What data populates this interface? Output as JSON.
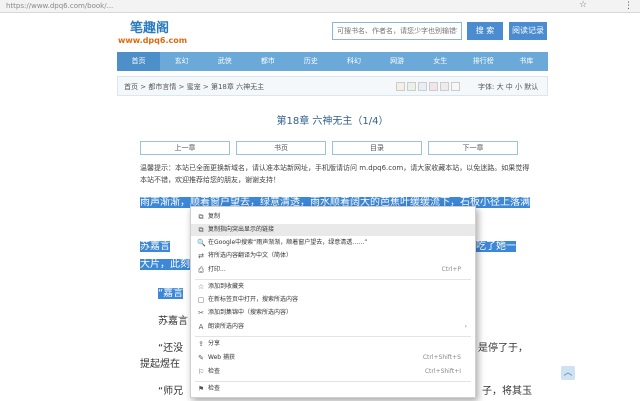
{
  "browser": {
    "url": "https://www.dpq6.com/book/...",
    "star_icon": "☆",
    "menu_icon": "⋮"
  },
  "header": {
    "logo_cn": "笔趣阁",
    "logo_en": "www.dpq6.com",
    "search_placeholder": "可搜书名、作者名，请您少字也别输错字",
    "search_button": "搜 索",
    "history_button": "阅读记录"
  },
  "nav": [
    "首页",
    "玄幻",
    "武侠",
    "都市",
    "历史",
    "科幻",
    "网游",
    "女生",
    "排行榜",
    "书库"
  ],
  "breadcrumb": "首页 > 都市言情 > 蜜宠 > 第18章 六神无主",
  "swatch_colors": [
    "#f4f0e4",
    "#e9f2e4",
    "#e6eef6",
    "#f0e6ea",
    "#ececec",
    "#f7f7f7"
  ],
  "font_controls": "字体: 大  中  小  默认",
  "chapter": {
    "title": "第18章 六神无主（1/4）",
    "nav_buttons": [
      "上一章",
      "书页",
      "目录",
      "下一章"
    ],
    "tip": "温馨提示：本站已全面更换新域名，请认准本站新网址，手机版请访问 m.dpq6.com，请大家收藏本站，以免迷路。如果觉得本站不错，欢迎推荐给您的朋友，谢谢支持！",
    "para1": "雨声渐渐，顺着窗户望去，绿意清透，雨水顺着阔大的芭蕉叶缓缓流下，石板小径上落满",
    "para2_start": "苏嘉言",
    "para2_end": "吃了她一",
    "para2_line2": "大片，此刻",
    "para3": "“嘉言",
    "para4": "苏嘉言",
    "para5_start": "“还没",
    "para5_end": "是停了于，",
    "para5_line2": "提起煜在",
    "para6_start": "“师兄",
    "para6_end": "子，将其玉"
  },
  "context_menu": {
    "items": [
      {
        "icon": "⧉",
        "label": "复制",
        "shortcut": "",
        "arrow": ""
      },
      {
        "icon": "⧉",
        "label": "复制指向突出显示的链接",
        "shortcut": "",
        "arrow": ""
      },
      {
        "icon": "🔍",
        "label": "在Google中搜索“雨声渐渐，顺着窗户望去，绿意清透……”",
        "shortcut": "",
        "arrow": ""
      },
      {
        "icon": "⇄",
        "label": "将所选内容翻译为中文（简体）",
        "shortcut": "",
        "arrow": ""
      },
      {
        "icon": "⎙",
        "label": "打印...",
        "shortcut": "Ctrl+P",
        "arrow": ""
      },
      {
        "icon": "☆",
        "label": "添加到收藏夹",
        "shortcut": "",
        "arrow": ""
      },
      {
        "icon": "▢",
        "label": "在新标签页中打开，搜索所选内容",
        "shortcut": "",
        "arrow": ""
      },
      {
        "icon": "✂",
        "label": "添加到集锦中（搜索所选内容）",
        "shortcut": "",
        "arrow": ""
      },
      {
        "icon": "A",
        "label": "朗读所选内容",
        "shortcut": "",
        "arrow": "›"
      },
      {
        "icon": "⇪",
        "label": "分享",
        "shortcut": "",
        "arrow": ""
      },
      {
        "icon": "✎",
        "label": "Web 捕获",
        "shortcut": "Ctrl+Shift+S",
        "arrow": ""
      },
      {
        "icon": "⚐",
        "label": "检查",
        "shortcut": "Ctrl+Shift+I",
        "arrow": ""
      },
      {
        "icon": "⚑",
        "label": "检查",
        "shortcut": "",
        "arrow": ""
      }
    ]
  },
  "scroll_top_icon": "︿"
}
